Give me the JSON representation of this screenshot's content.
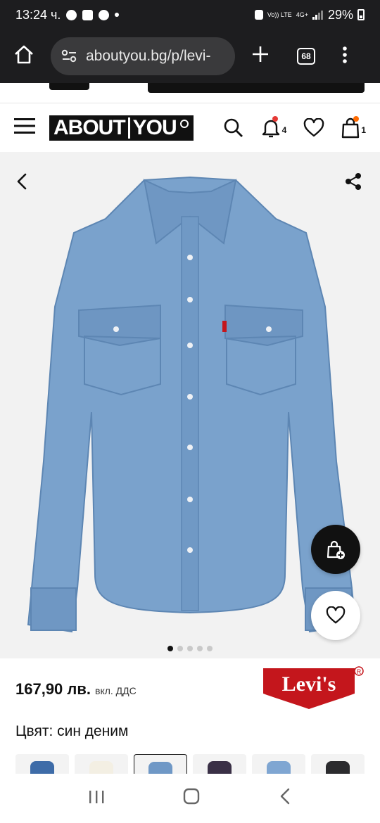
{
  "status_bar": {
    "time": "13:24 ч.",
    "network_volte": "Vo)) LTE",
    "network_gen": "4G+",
    "battery": "29%"
  },
  "browser": {
    "url": "aboutyou.bg/p/levi-",
    "tab_count": "68"
  },
  "header": {
    "logo_left": "ABOUT",
    "logo_right": "YOU",
    "notifications_count": "4",
    "cart_count": "1"
  },
  "product": {
    "price": "167,90 лв.",
    "vat_note": "вкл. ДДС",
    "brand": "Levi's",
    "color_label": "Цвят: син деним",
    "gallery_total_images": 5,
    "gallery_active_index": 0,
    "swatch_colors": [
      "#3e6ca8",
      "#f3efe3",
      "#6f98c6",
      "#3a3046",
      "#7fa6d2",
      "#2b2b2e"
    ],
    "selected_swatch_index": 2
  },
  "colors": {
    "denim": "#7aa2cc",
    "brand_red": "#c4161c",
    "accent_orange": "#ff6a00",
    "badge_red": "#e53935"
  }
}
